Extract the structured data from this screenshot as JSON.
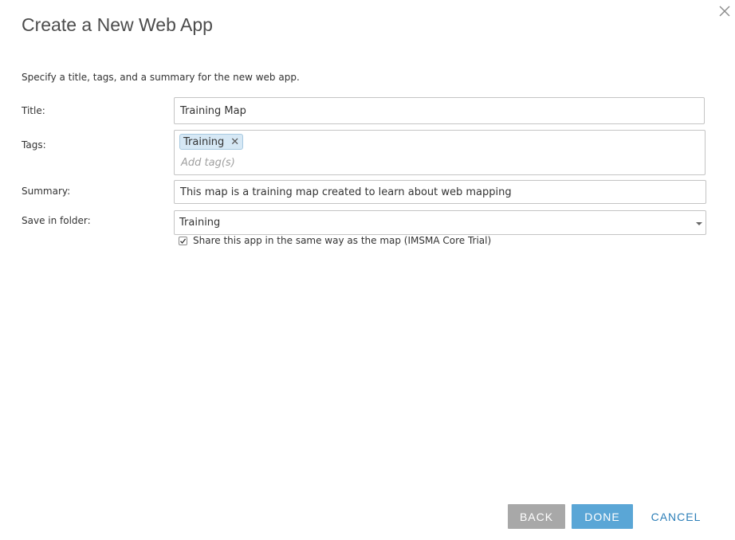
{
  "dialog": {
    "title": "Create a New Web App",
    "instructions": "Specify a title, tags, and a summary for the new web app."
  },
  "form": {
    "title_label": "Title:",
    "title_value": "Training Map",
    "tags_label": "Tags:",
    "tags": [
      {
        "label": "Training"
      }
    ],
    "tags_placeholder": "Add tag(s)",
    "summary_label": "Summary:",
    "summary_value": "This map is a training map created to learn about web mapping",
    "folder_label": "Save in folder:",
    "folder_value": "Training",
    "share_label": "Share this app in the same way as the map (IMSMA Core Trial)",
    "share_checked": true
  },
  "buttons": {
    "back": "BACK",
    "done": "DONE",
    "cancel": "CANCEL"
  },
  "colors": {
    "done_button": "#5aa6d6",
    "back_button": "#a8a8a8",
    "cancel_text": "#2d7fb8",
    "tag_chip": "#d6e8f5"
  },
  "icons": {
    "close": "close-icon",
    "tag_remove": "tag-remove-icon",
    "dropdown": "chevron-down-icon",
    "checkbox": "checkmark-icon"
  }
}
